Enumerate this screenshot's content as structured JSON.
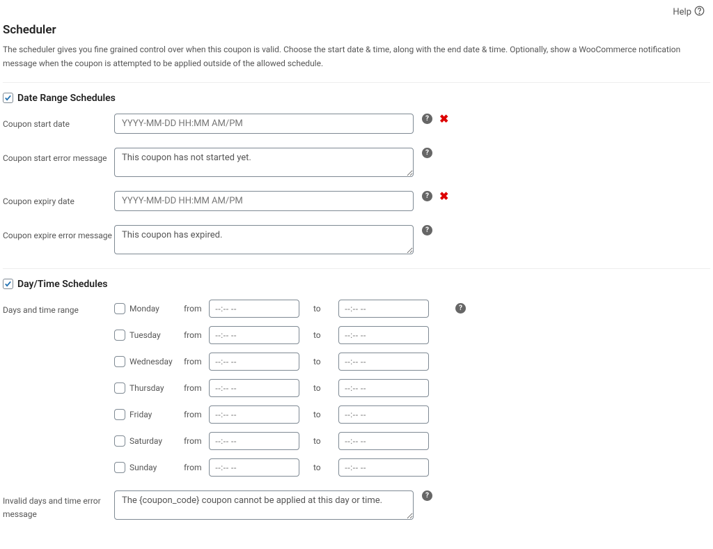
{
  "help": {
    "label": "Help"
  },
  "page": {
    "title": "Scheduler",
    "description": "The scheduler gives you fine grained control over when this coupon is valid. Choose the start date & time, along with the end date & time. Optionally, show a WooCommerce notification message when the coupon is attempted to be applied outside of the allowed schedule."
  },
  "sections": {
    "date_range": {
      "title": "Date Range Schedules"
    },
    "day_time": {
      "title": "Day/Time Schedules"
    }
  },
  "fields": {
    "start_date": {
      "label": "Coupon start date",
      "placeholder": "YYYY-MM-DD HH:MM AM/PM"
    },
    "start_error": {
      "label": "Coupon start error message",
      "value": "This coupon has not started yet."
    },
    "expiry_date": {
      "label": "Coupon expiry date",
      "placeholder": "YYYY-MM-DD HH:MM AM/PM"
    },
    "expire_error": {
      "label": "Coupon expire error message",
      "value": "This coupon has expired."
    },
    "days_range": {
      "label": "Days and time range"
    },
    "invalid_days": {
      "label": "Invalid days and time error message",
      "value": "The {coupon_code} coupon cannot be applied at this day or time."
    }
  },
  "day_rows": {
    "from": "from",
    "to": "to",
    "time_placeholder": "--:-- --",
    "days": [
      "Monday",
      "Tuesday",
      "Wednesday",
      "Thursday",
      "Friday",
      "Saturday",
      "Sunday"
    ]
  }
}
